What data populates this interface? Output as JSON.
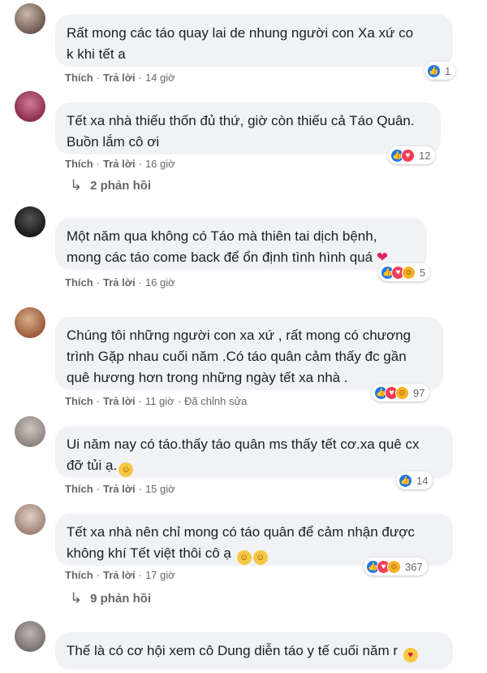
{
  "comments": [
    {
      "text": "Rất mong các táo quay lai de nhung người con Xa xứ co\nk khi tết a",
      "actions": {
        "like": "Thích",
        "reply": "Trả lời",
        "time": "14 giờ"
      },
      "reactions": {
        "count": "1",
        "types": [
          "like"
        ]
      }
    },
    {
      "text": "Tết xa nhà thiếu thốn đủ thứ, giờ còn thiếu cả Táo Quân.\nBuồn lắm cô ơi",
      "actions": {
        "like": "Thích",
        "reply": "Trả lời",
        "time": "16 giờ"
      },
      "reactions": {
        "count": "12",
        "types": [
          "like",
          "love"
        ]
      },
      "replies": "2 phản hồi"
    },
    {
      "text": "Một năm qua không có Táo mà thiên tai dịch bệnh,\nmong các táo come back để ổn định tình hình quá",
      "actions": {
        "like": "Thích",
        "reply": "Trả lời",
        "time": "16 giờ"
      },
      "reactions": {
        "count": "5",
        "types": [
          "like",
          "love",
          "haha"
        ]
      }
    },
    {
      "text": "Chúng tôi những người con xa xứ , rất mong có chương\ntrình Gặp nhau cuối năm .Có táo quân cảm thấy đc gần\nquê hương hơn trong những ngày tết xa nhà .",
      "actions": {
        "like": "Thích",
        "reply": "Trả lời",
        "time": "11 giờ",
        "edited": "Đã chỉnh sửa"
      },
      "reactions": {
        "count": "97",
        "types": [
          "like",
          "love",
          "haha"
        ]
      }
    },
    {
      "text": "Ui năm nay có táo.thấy táo quân ms thấy tết cơ.xa quê cx\nđỡ tủi ạ.",
      "actions": {
        "like": "Thích",
        "reply": "Trả lời",
        "time": "15 giờ"
      },
      "reactions": {
        "count": "14",
        "types": [
          "like"
        ]
      }
    },
    {
      "text": "Tết xa nhà nên chỉ mong có táo quân để cảm nhận được\nkhông khí Tết việt thôi cô ạ",
      "actions": {
        "like": "Thích",
        "reply": "Trả lời",
        "time": "17 giờ"
      },
      "reactions": {
        "count": "367",
        "types": [
          "like",
          "love",
          "haha"
        ]
      },
      "replies": "9 phản hồi"
    },
    {
      "text": "Thế là có cơ hội xem cô Dung diễn táo y tế cuối năm r"
    }
  ],
  "colors": {
    "like": "#1877f2",
    "love": "#f33e58",
    "haha": "#f7b125",
    "bubble": "#f0f2f5",
    "meta": "#65676b"
  }
}
